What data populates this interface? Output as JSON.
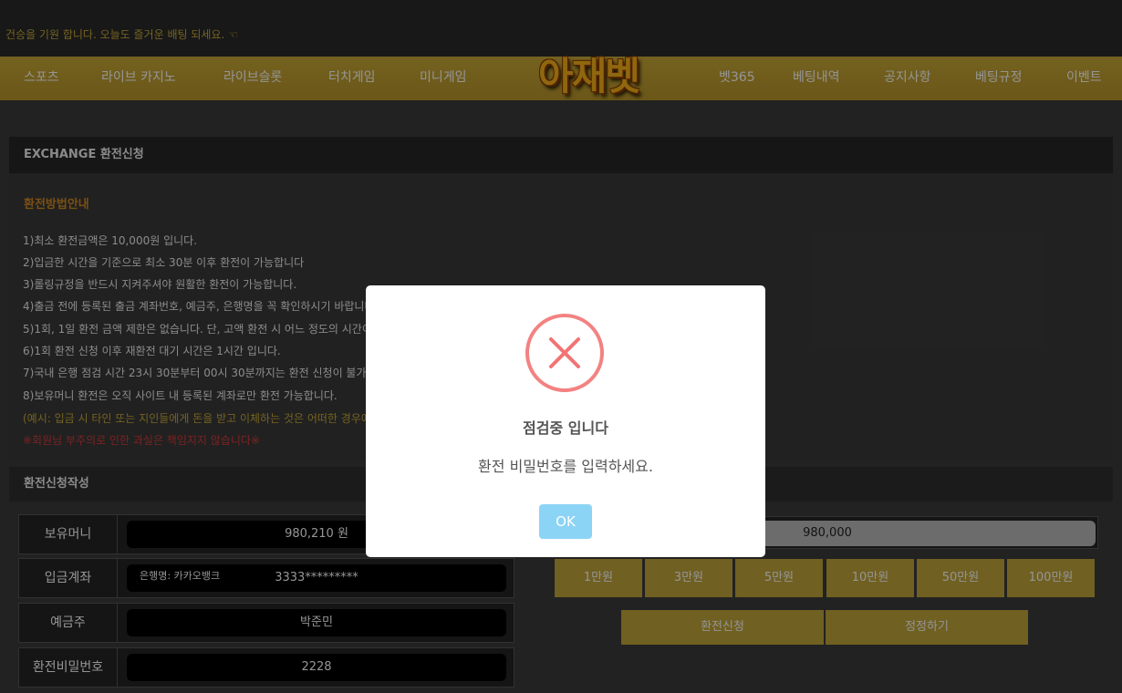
{
  "top": {
    "marquee": "건승을 기원 합니다. 오늘도 즐거운 배팅 되세요. ☜"
  },
  "nav": {
    "left": [
      "스포츠",
      "라이브 카지노",
      "라이브슬롯",
      "터치게임",
      "미니게임"
    ],
    "logo": "아재벳",
    "right": [
      "벳365",
      "베팅내역",
      "공지사항",
      "베팅규정",
      "이벤트"
    ]
  },
  "exchange": {
    "header": "EXCHANGE 환전신청",
    "guide_title": "환전방법안내",
    "guide_lines": [
      "1)최소 환전금액은 10,000원 입니다.",
      "2)입금한 시간을 기준으로 최소 30분 이후 환전이 가능합니다",
      "3)롤링규정을 반드시 지켜주셔야 원활한 환전이 가능합니다.",
      "4)출금 전에 등록된 출금 계좌번호, 예금주, 은행명을 꼭 확인하시기 바랍니다.",
      "5)1회, 1일 환전 금액 제한은 없습니다. 단, 고액 환전 시 어느 정도의 시간이 소요될 수 있습니다.",
      "6)1회 환전 신청 이후 재환전 대기 시간은 1시간 입니다.",
      "7)국내 은행 점검 시간 23시 30분부터 00시 30분까지는 환전 신청이 불가능합니다.",
      "8)보유머니 환전은 오직 사이트 내 등록된 계좌로만 환전 가능합니다."
    ],
    "warning_yellow": "(예시: 입금 시 타인 또는 지인들에게 돈을 받고 이체하는 것은 어떠한 경우에도 불가능합니다.)",
    "warning_red": "※회원님 부주의로 인한 과실은 책임지지 않습니다※"
  },
  "form": {
    "title": "환전신청작성",
    "balance_label": "보유머니",
    "balance_value": "980,210 원",
    "account_label": "입금계좌",
    "bank_name": "은행명: 카카오뱅크",
    "account_number": "3333*********",
    "holder_label": "예금주",
    "holder_value": "박준민",
    "password_label": "환전비밀번호",
    "password_value": "2228",
    "amount_value": "980,000",
    "presets": [
      "1만원",
      "3만원",
      "5만원",
      "10만원",
      "50만원",
      "100만원"
    ],
    "submit_label": "환전신청",
    "reset_label": "정정하기"
  },
  "modal": {
    "title": "점검중 입니다",
    "text": "환전 비밀번호를 입력하세요.",
    "ok_label": "OK",
    "icon_color": "#f27474",
    "ok_color": "#8cd4f5"
  }
}
